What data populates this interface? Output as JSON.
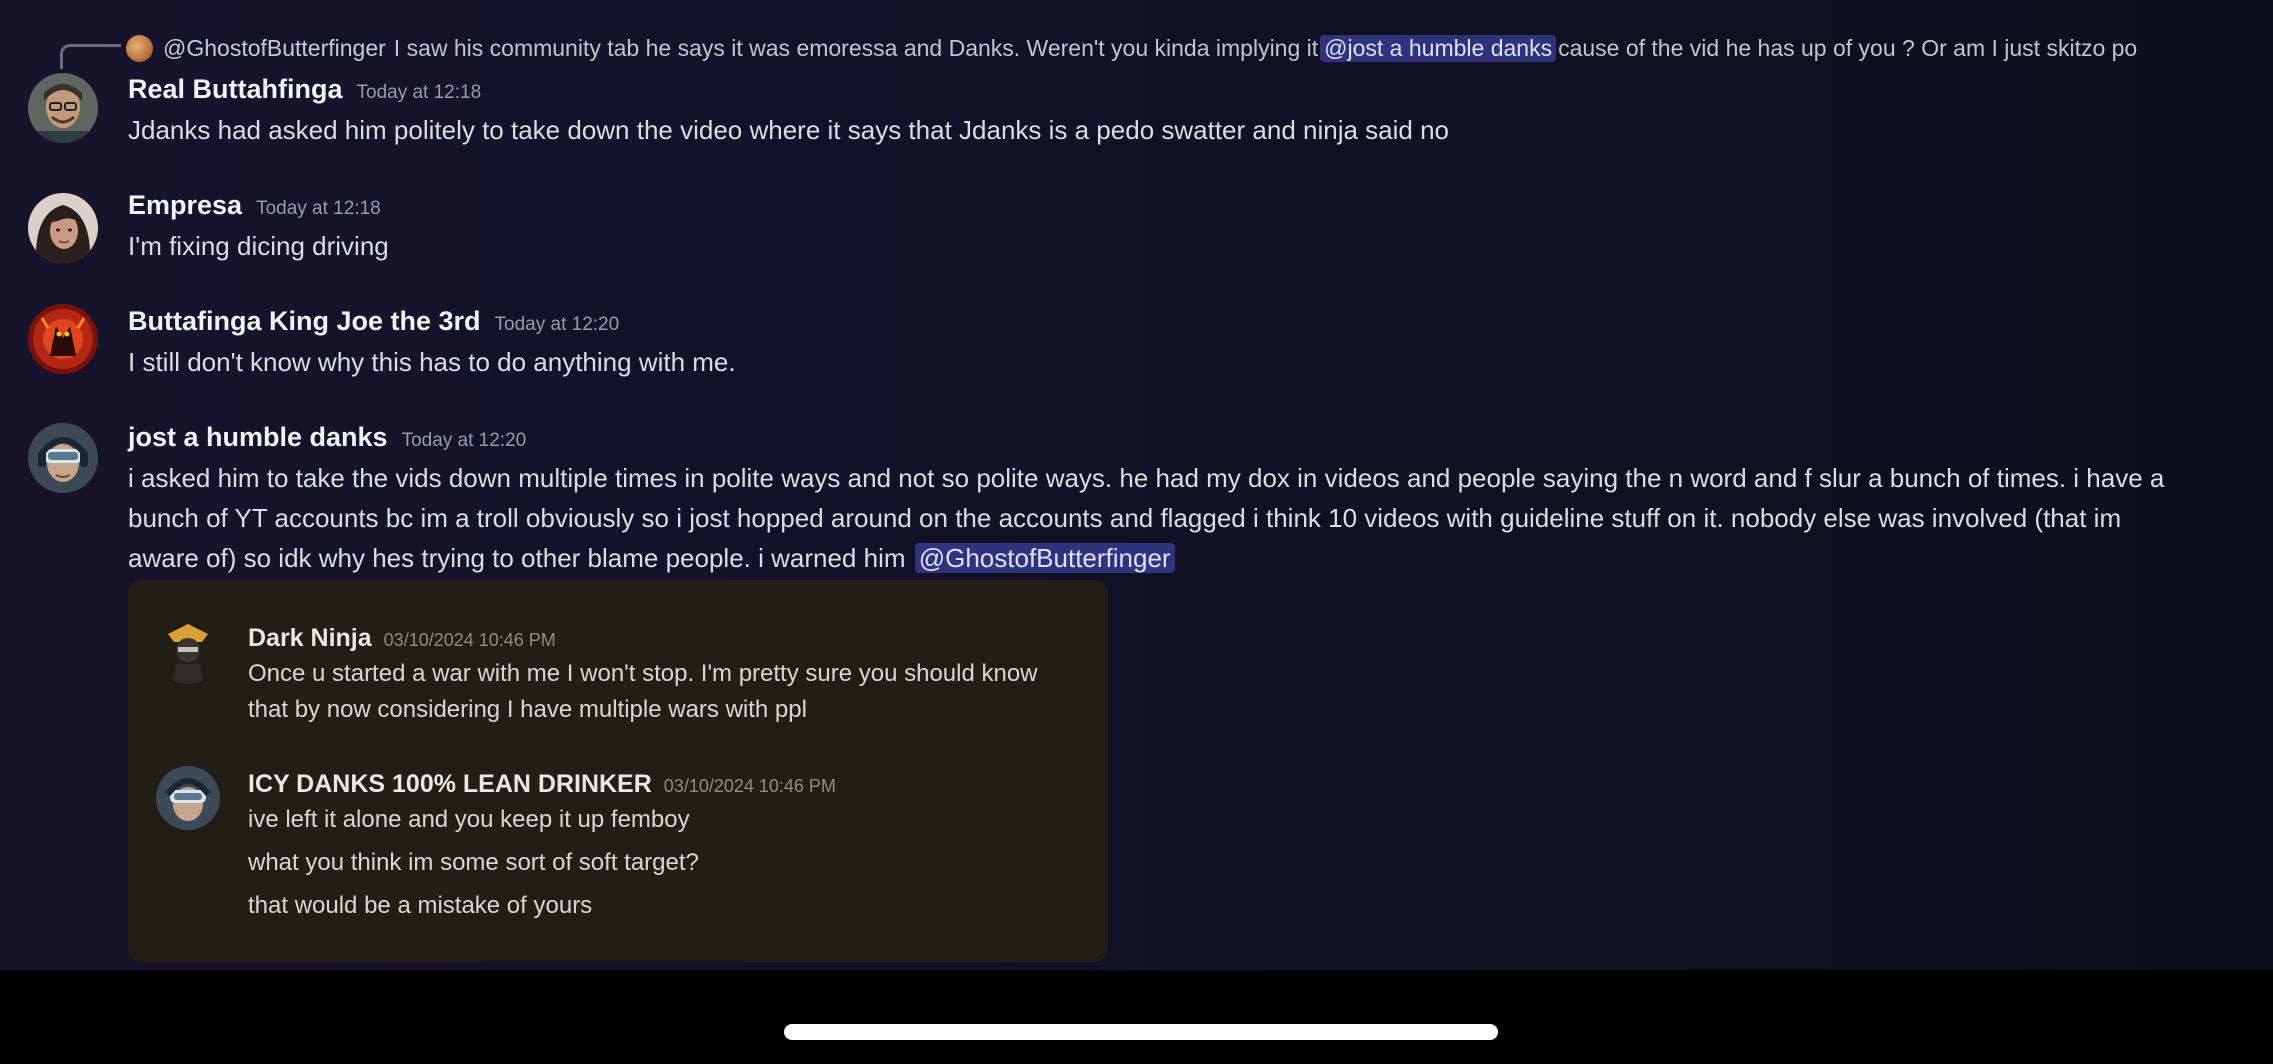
{
  "reply": {
    "author": "@GhostofButterfinger",
    "text_before": "I saw his community tab he says it was emoressa and Danks. Weren't you kinda implying it",
    "mention": "@jost a humble danks",
    "text_after": "cause of the vid he has up of you ? Or am I just skitzo po"
  },
  "messages": [
    {
      "username": "Real Buttahfinga",
      "timestamp": "Today at 12:18",
      "text": "Jdanks had asked him politely to take down the video where it says that Jdanks is a pedo swatter and ninja said no"
    },
    {
      "username": "Empresa",
      "timestamp": "Today at 12:18",
      "text": "I'm fixing dicing driving"
    },
    {
      "username": "Buttafinga King Joe the 3rd",
      "timestamp": "Today at 12:20",
      "text": "I still don't know why this has to do anything with me."
    },
    {
      "username": "jost a humble danks",
      "timestamp": "Today at 12:20",
      "text": "i asked him to take the vids down multiple times in polite ways and not so polite ways. he had my dox in videos and people saying the n word and f slur a bunch of times. i have a bunch of YT accounts bc im a troll obviously so i jost hopped around on the accounts and flagged i think 10 videos with guideline stuff on it. nobody else was involved (that im aware of) so idk why hes trying to other blame people. i warned him",
      "mention": "@GhostofButterfinger"
    }
  ],
  "embed": {
    "messages": [
      {
        "username": "Dark Ninja",
        "timestamp": "03/10/2024 10:46 PM",
        "lines": [
          "Once u started a war with me I won't stop. I'm pretty sure you should know",
          "that by now considering I have multiple wars with ppl"
        ]
      },
      {
        "username": "ICY DANKS 100% LEAN DRINKER",
        "timestamp": "03/10/2024 10:46 PM",
        "lines": [
          "ive left it alone and you keep it up femboy",
          "what you think im some sort of soft target?",
          "that would be a mistake of yours"
        ]
      }
    ]
  },
  "icons": {
    "reply": "reply-arrow-icon",
    "avatars": [
      "avatar-real-buttahfinga",
      "avatar-empresa",
      "avatar-buttafinga-king-joe",
      "avatar-jost-a-humble-danks",
      "avatar-dark-ninja",
      "avatar-icy-danks"
    ]
  },
  "colors": {
    "background": "#15122a",
    "mention_bg": "#5865f2",
    "embed_bg": "#211f15"
  }
}
